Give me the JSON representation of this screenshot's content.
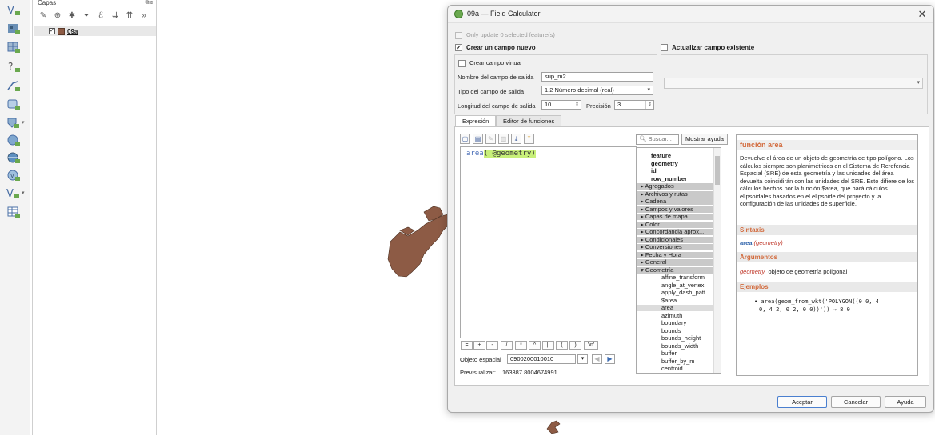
{
  "layers_panel": {
    "title": "Capas",
    "layer_name": "09a"
  },
  "dialog": {
    "title": "09a — Field Calculator",
    "only_update_label": "Only update 0 selected feature(s)",
    "create_new_field_label": "Crear un campo nuevo",
    "update_existing_label": "Actualizar campo existente",
    "virtual_field_label": "Crear campo virtual",
    "output_name_label": "Nombre del campo de salida",
    "output_name_value": "sup_m2",
    "output_type_label": "Tipo del campo de salida",
    "output_type_value": "1.2 Número decimal (real)",
    "output_length_label": "Longitud del campo de salida",
    "output_length_value": "10",
    "precision_label": "Precisión",
    "precision_value": "3",
    "tabs": [
      "Expresión",
      "Editor de funciones"
    ],
    "expression": {
      "fn": "area",
      "arg": "( @geometry)"
    },
    "operators": [
      "=",
      "+",
      "-",
      "/",
      "*",
      "^",
      "||",
      "(",
      ")",
      "'\\n'"
    ],
    "feature_label": "Objeto espacial",
    "feature_value": "0900200010010",
    "preview_label": "Previsualizar:",
    "preview_value": "163387.8004674991",
    "search_placeholder": "Buscar...",
    "show_help_label": "Mostrar ayuda",
    "function_list": [
      {
        "text": "feature",
        "kind": "bold"
      },
      {
        "text": "geometry",
        "kind": "bold"
      },
      {
        "text": "id",
        "kind": "bold"
      },
      {
        "text": "row_number",
        "kind": "bold"
      },
      {
        "text": "Agregados",
        "kind": "group"
      },
      {
        "text": "Archivos y rutas",
        "kind": "group"
      },
      {
        "text": "Cadena",
        "kind": "group"
      },
      {
        "text": "Campos y valores",
        "kind": "group"
      },
      {
        "text": "Capas de mapa",
        "kind": "group"
      },
      {
        "text": "Color",
        "kind": "group"
      },
      {
        "text": "Concordancia aprox...",
        "kind": "group"
      },
      {
        "text": "Condicionales",
        "kind": "group"
      },
      {
        "text": "Conversiones",
        "kind": "group"
      },
      {
        "text": "Fecha y Hora",
        "kind": "group"
      },
      {
        "text": "General",
        "kind": "group"
      },
      {
        "text": "Geometría",
        "kind": "group-open"
      },
      {
        "text": "affine_transform",
        "kind": "child"
      },
      {
        "text": "angle_at_vertex",
        "kind": "child"
      },
      {
        "text": "apply_dash_patt...",
        "kind": "child"
      },
      {
        "text": "$area",
        "kind": "child"
      },
      {
        "text": "area",
        "kind": "child-selected"
      },
      {
        "text": "azimuth",
        "kind": "child"
      },
      {
        "text": "boundary",
        "kind": "child"
      },
      {
        "text": "bounds",
        "kind": "child"
      },
      {
        "text": "bounds_height",
        "kind": "child"
      },
      {
        "text": "bounds_width",
        "kind": "child"
      },
      {
        "text": "buffer",
        "kind": "child"
      },
      {
        "text": "buffer_by_m",
        "kind": "child"
      },
      {
        "text": "centroid",
        "kind": "child"
      }
    ],
    "help": {
      "title": "función area",
      "description": "Devuelve el área de un objeto de geometría de tipo polígono. Los cálculos siempre son planimétricos en el Sistema de Rerefencia Espacial (SRE) de esta geometría y las unidades del área devuelta coincidirán con las unidades del SRE. Esto difiere de los cálculos hechos por la función $area, que hará cálculos elipsoidales basados en el elipsoide del proyecto y la configuración de las unidades de superficie.",
      "syntax_head": "Sintaxis",
      "syntax_fn": "area",
      "syntax_arg": "(geometry)",
      "args_head": "Argumentos",
      "arg_name": "geometry",
      "arg_desc": "objeto de geometría poligonal",
      "examples_head": "Ejemplos",
      "example_line1": "• area(geom_from_wkt('POLYGON((0 0, 4",
      "example_line2": "0, 4 2, 0 2, 0 0))')) → 8.0"
    },
    "buttons": {
      "ok": "Aceptar",
      "cancel": "Cancelar",
      "help": "Ayuda"
    }
  }
}
